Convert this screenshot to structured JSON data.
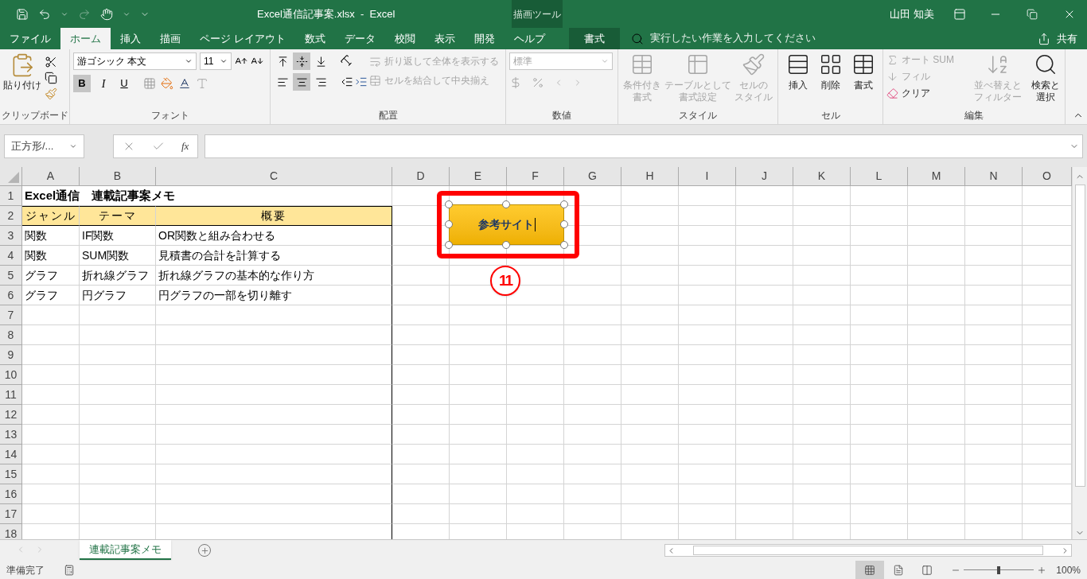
{
  "title_bar": {
    "document_title": "Excel通信記事案.xlsx  -  Excel",
    "context_label": "描画ツール",
    "user": "山田 知美"
  },
  "tabs": [
    {
      "label": "ファイル",
      "selected": false,
      "kind": "normal"
    },
    {
      "label": "ホーム",
      "selected": true,
      "kind": "normal"
    },
    {
      "label": "挿入",
      "selected": false,
      "kind": "normal"
    },
    {
      "label": "描画",
      "selected": false,
      "kind": "normal"
    },
    {
      "label": "ページ レイアウト",
      "selected": false,
      "kind": "normal"
    },
    {
      "label": "数式",
      "selected": false,
      "kind": "normal"
    },
    {
      "label": "データ",
      "selected": false,
      "kind": "normal"
    },
    {
      "label": "校閲",
      "selected": false,
      "kind": "normal"
    },
    {
      "label": "表示",
      "selected": false,
      "kind": "normal"
    },
    {
      "label": "開発",
      "selected": false,
      "kind": "normal"
    },
    {
      "label": "ヘルプ",
      "selected": false,
      "kind": "normal"
    },
    {
      "label": "書式",
      "selected": false,
      "kind": "contextual"
    }
  ],
  "tell_me": {
    "placeholder": "実行したい作業を入力してください"
  },
  "share": "共有",
  "ribbon": {
    "groups": [
      {
        "kind": "clipboard",
        "label": "クリップボード",
        "paste": "貼り付け"
      },
      {
        "kind": "font",
        "label": "フォント",
        "font_name": "游ゴシック 本文",
        "font_size": "11",
        "bold": true,
        "bold_label": "B",
        "italic_label": "I",
        "underline_label": "U"
      },
      {
        "kind": "alignment",
        "label": "配置",
        "vertical_align": [
          {
            "selected": false
          },
          {
            "selected": true
          },
          {
            "selected": false
          }
        ],
        "horizontal_align": [
          {
            "selected": false
          },
          {
            "selected": true
          },
          {
            "selected": false
          }
        ],
        "buttons": [
          {
            "label": "折り返して全体を表示する",
            "disabled": true
          },
          {
            "label": "セルを結合して中央揃え",
            "disabled": true
          }
        ]
      },
      {
        "kind": "number",
        "label": "数値",
        "format": "標準",
        "disabled": true
      },
      {
        "kind": "styles",
        "label": "スタイル",
        "buttons": [
          {
            "lines": [
              "条件付き",
              "書式"
            ],
            "disabled": true
          },
          {
            "lines": [
              "テーブルとして",
              "書式設定"
            ],
            "disabled": true
          },
          {
            "lines": [
              "セルの",
              "スタイル"
            ],
            "disabled": true
          }
        ]
      },
      {
        "kind": "cells",
        "label": "セル",
        "buttons": [
          {
            "lines": [
              "挿入"
            ],
            "disabled": false
          },
          {
            "lines": [
              "削除"
            ],
            "disabled": false
          },
          {
            "lines": [
              "書式"
            ],
            "disabled": false
          }
        ]
      },
      {
        "kind": "editing",
        "label": "編集",
        "small_buttons": [
          {
            "label": "オート SUM",
            "disabled": true
          },
          {
            "label": "フィル",
            "disabled": true
          },
          {
            "label": "クリア",
            "disabled": false
          }
        ],
        "buttons": [
          {
            "lines": [
              "並べ替えと",
              "フィルター"
            ],
            "disabled": true
          },
          {
            "lines": [
              "検索と",
              "選択"
            ],
            "disabled": false
          }
        ]
      }
    ]
  },
  "formula_bar": {
    "name_box": "正方形/...",
    "function_label": "fx"
  },
  "sheet": {
    "columns": [
      "A",
      "B",
      "C",
      "D",
      "E",
      "F",
      "G",
      "H",
      "I",
      "J",
      "K",
      "L",
      "M",
      "N",
      "O"
    ],
    "rows": [
      {
        "number": "1",
        "kind": "title",
        "cells": [
          "Excel通信　連載記事案メモ"
        ]
      },
      {
        "number": "2",
        "kind": "header",
        "cells": [
          "ジャンル",
          "テーマ",
          "概要"
        ]
      },
      {
        "number": "3",
        "kind": "data",
        "cells": [
          "関数",
          "IF関数",
          "OR関数と組み合わせる"
        ]
      },
      {
        "number": "4",
        "kind": "data",
        "cells": [
          "関数",
          "SUM関数",
          "見積書の合計を計算する"
        ]
      },
      {
        "number": "5",
        "kind": "data",
        "cells": [
          "グラフ",
          "折れ線グラフ",
          "折れ線グラフの基本的な作り方"
        ]
      },
      {
        "number": "6",
        "kind": "data",
        "cells": [
          "グラフ",
          "円グラフ",
          "円グラフの一部を切り離す"
        ]
      },
      {
        "number": "7",
        "kind": "data"
      },
      {
        "number": "8",
        "kind": "data"
      },
      {
        "number": "9",
        "kind": "data"
      },
      {
        "number": "10",
        "kind": "data"
      },
      {
        "number": "11",
        "kind": "data"
      },
      {
        "number": "12",
        "kind": "data"
      },
      {
        "number": "13",
        "kind": "data"
      },
      {
        "number": "14",
        "kind": "data"
      },
      {
        "number": "15",
        "kind": "data"
      },
      {
        "number": "16",
        "kind": "data"
      },
      {
        "number": "17",
        "kind": "data"
      },
      {
        "number": "18",
        "kind": "data"
      }
    ],
    "shape": {
      "text": "参考サイト",
      "selected": true
    },
    "annotation": "11"
  },
  "sheet_tabs": [
    {
      "label": "連載記事案メモ",
      "selected": true
    }
  ],
  "status_bar": {
    "status": "準備完了",
    "views": [
      {
        "selected": true
      },
      {
        "selected": false
      },
      {
        "selected": false
      }
    ],
    "zoom_slider": {
      "level": 0.5
    },
    "zoom": "100%"
  }
}
